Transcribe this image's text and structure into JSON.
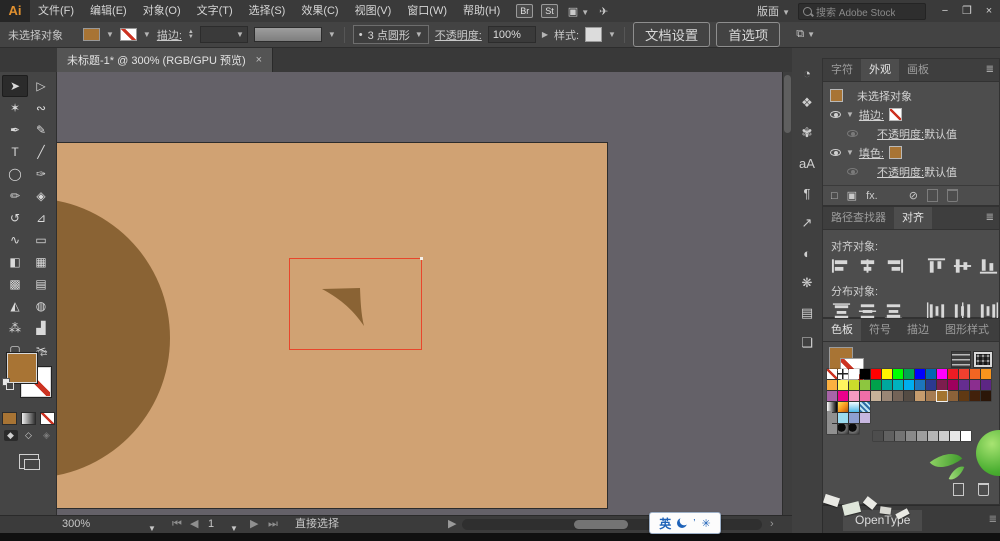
{
  "menu_bar": {
    "logo": "Ai",
    "items": [
      "文件(F)",
      "编辑(E)",
      "对象(O)",
      "文字(T)",
      "选择(S)",
      "效果(C)",
      "视图(V)",
      "窗口(W)",
      "帮助(H)"
    ],
    "badges": [
      "Br",
      "St"
    ],
    "workspace_label": "版面",
    "search_placeholder": "搜索 Adobe Stock",
    "window_controls": {
      "minimize": "−",
      "restore": "❐",
      "close": "×"
    }
  },
  "control_bar": {
    "no_selection": "未选择对象",
    "stroke_label": "描边:",
    "brush_dot": "•",
    "brush_value": "3 点圆形",
    "opacity_label": "不透明度:",
    "opacity_value": "100%",
    "style_label": "样式:",
    "doc_setup_button": "文档设置",
    "preferences_button": "首选项"
  },
  "document_tab": {
    "title": "未标题-1* @ 300% (RGB/GPU 预览)",
    "close": "×"
  },
  "toolbar": {
    "tools": [
      {
        "name": "selection-tool",
        "glyph": "➤",
        "active": true
      },
      {
        "name": "direct-selection-tool",
        "glyph": "▷",
        "active": false
      },
      {
        "name": "magic-wand-tool",
        "glyph": "✶",
        "active": false
      },
      {
        "name": "lasso-tool",
        "glyph": "∾",
        "active": false
      },
      {
        "name": "pen-tool",
        "glyph": "✒",
        "active": false
      },
      {
        "name": "curvature-tool",
        "glyph": "✎",
        "active": false
      },
      {
        "name": "type-tool",
        "glyph": "T",
        "active": false
      },
      {
        "name": "line-segment-tool",
        "glyph": "╱",
        "active": false
      },
      {
        "name": "ellipse-tool",
        "glyph": "◯",
        "active": false
      },
      {
        "name": "paintbrush-tool",
        "glyph": "✑",
        "active": false
      },
      {
        "name": "pencil-tool",
        "glyph": "✏",
        "active": false
      },
      {
        "name": "eraser-tool",
        "glyph": "◈",
        "active": false
      },
      {
        "name": "rotate-tool",
        "glyph": "↺",
        "active": false
      },
      {
        "name": "scale-tool",
        "glyph": "⊿",
        "active": false
      },
      {
        "name": "width-tool",
        "glyph": "∿",
        "active": false
      },
      {
        "name": "free-transform-tool",
        "glyph": "▭",
        "active": false
      },
      {
        "name": "shape-builder-tool",
        "glyph": "◧",
        "active": false
      },
      {
        "name": "perspective-grid-tool",
        "glyph": "▦",
        "active": false
      },
      {
        "name": "mesh-tool",
        "glyph": "▩",
        "active": false
      },
      {
        "name": "gradient-tool",
        "glyph": "▤",
        "active": false
      },
      {
        "name": "eyedropper-tool",
        "glyph": "◭",
        "active": false
      },
      {
        "name": "blend-tool",
        "glyph": "◍",
        "active": false
      },
      {
        "name": "symbol-sprayer-tool",
        "glyph": "⁂",
        "active": false
      },
      {
        "name": "column-graph-tool",
        "glyph": "▟",
        "active": false
      },
      {
        "name": "artboard-tool",
        "glyph": "▢",
        "active": false
      },
      {
        "name": "slice-tool",
        "glyph": "✂",
        "active": false
      },
      {
        "name": "hand-tool",
        "glyph": "✋",
        "active": false
      },
      {
        "name": "zoom-tool",
        "glyph": "⊙",
        "active": false
      }
    ]
  },
  "colors": {
    "fill_brown": "#a87434",
    "artboard_tan": "#d0a273",
    "shape_brown": "#8a6334",
    "selection_red": "#e8462b"
  },
  "dock_icons": [
    {
      "name": "shape-properties",
      "glyph": "◔"
    },
    {
      "name": "asset-export",
      "glyph": "❖"
    },
    {
      "name": "brushes",
      "glyph": "✾"
    },
    {
      "name": "character-styles",
      "glyph": "aA"
    },
    {
      "name": "paragraph-styles",
      "glyph": "¶"
    },
    {
      "name": "export",
      "glyph": "↗"
    },
    {
      "name": "transparency",
      "glyph": "◐"
    },
    {
      "name": "color",
      "glyph": "❋"
    },
    {
      "name": "gradient",
      "glyph": "▤"
    },
    {
      "name": "layers",
      "glyph": "❏"
    }
  ],
  "appearance_panel": {
    "tabs": [
      "字符",
      "外观",
      "画板"
    ],
    "active_tab": "外观",
    "no_selection": "未选择对象",
    "stroke_label": "描边:",
    "fill_label": "填色:",
    "opacity_label": "不透明度:",
    "opacity_value": "默认值",
    "fx_label": "fx."
  },
  "align_panel": {
    "tabs": [
      "路径查找器",
      "对齐"
    ],
    "active_tab": "对齐",
    "align_objects_label": "对齐对象:",
    "distribute_objects_label": "分布对象:",
    "align_icons": [
      "h-left",
      "h-center",
      "h-right",
      "v-top",
      "v-middle",
      "v-bottom"
    ],
    "distribute_icons": [
      "dv-top",
      "dv-middle",
      "dv-bottom",
      "dh-left",
      "dh-center",
      "dh-right"
    ]
  },
  "swatches_panel": {
    "tabs": [
      "色板",
      "符号",
      "描边",
      "图形样式"
    ],
    "active_tab": "色板",
    "rows": [
      [
        "none",
        "reg",
        "#ffffff",
        "#000000",
        "#ff0000",
        "#fff200",
        "#00ff00",
        "#00a651",
        "#0000ff",
        "#0066b3",
        "#ff00ff",
        "#ed1c24",
        "#f0402f",
        "#f26522",
        "#f7941d"
      ],
      [
        "#fbb040",
        "#fff45f",
        "#cadb2b",
        "#8dc63f",
        "#00a14b",
        "#00a79d",
        "#00b2bf",
        "#00aeef",
        "#1c75bc",
        "#2b3990",
        "#7c1d4d",
        "#9e005d",
        "#652d90",
        "#8b2e8f",
        "#5d2684"
      ],
      [
        "#a864a8",
        "#ec008c",
        "#f49ac1",
        "#ef6ea8",
        "#c7b299",
        "#998675",
        "#736357",
        "#544b43",
        "#c69c6d",
        "#a67c52",
        "sel:#a3742f",
        "#8c6239",
        "#603913",
        "#42210b",
        "#2b1608"
      ],
      [
        "grad-bw",
        "grad-or",
        "grad-sky",
        "pattern"
      ],
      [
        "folder",
        "#9bdcf0",
        "#8e9fd1",
        "#c8b7e0"
      ],
      [
        "folder",
        "blob",
        "blob"
      ]
    ],
    "grays": [
      "#4d4d4d",
      "#606060",
      "#737373",
      "#898989",
      "#9e9e9e",
      "#b5b5b5",
      "#cccccc",
      "#e8e8e8",
      "#ffffff"
    ]
  },
  "opentype_panel": {
    "label": "OpenType"
  },
  "status_bar": {
    "zoom": "300%",
    "artboard_value": "1",
    "tool_status": "直接选择"
  },
  "ime": {
    "lang": "英"
  }
}
